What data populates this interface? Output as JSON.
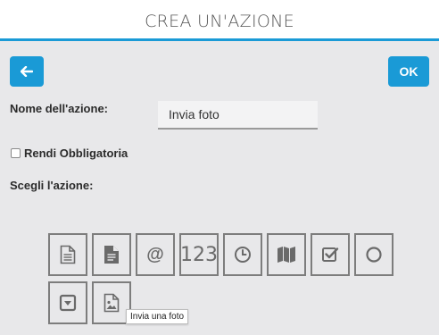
{
  "header": {
    "title": "CREA UN'AZIONE"
  },
  "toolbar": {
    "back_icon": "arrow-left-icon",
    "ok_label": "OK"
  },
  "form": {
    "name_label": "Nome dell'azione:",
    "name_value": "Invia foto",
    "mandatory_label": "Rendi Obbligatoria",
    "mandatory_checked": false,
    "choose_label": "Scegli l'azione:"
  },
  "actions": [
    {
      "icon": "document-outline-icon"
    },
    {
      "icon": "document-filled-icon"
    },
    {
      "icon": "at-sign-icon",
      "text": "@"
    },
    {
      "icon": "number-icon",
      "text": "123"
    },
    {
      "icon": "clock-icon"
    },
    {
      "icon": "map-icon"
    },
    {
      "icon": "checkbox-icon"
    },
    {
      "icon": "radio-circle-icon"
    },
    {
      "icon": "dropdown-icon"
    },
    {
      "icon": "image-icon"
    }
  ],
  "tooltip": {
    "text": "Invia una foto"
  },
  "colors": {
    "accent": "#1a9ad6",
    "background": "#e8e8ea",
    "tile_border": "#7d7d7d"
  }
}
